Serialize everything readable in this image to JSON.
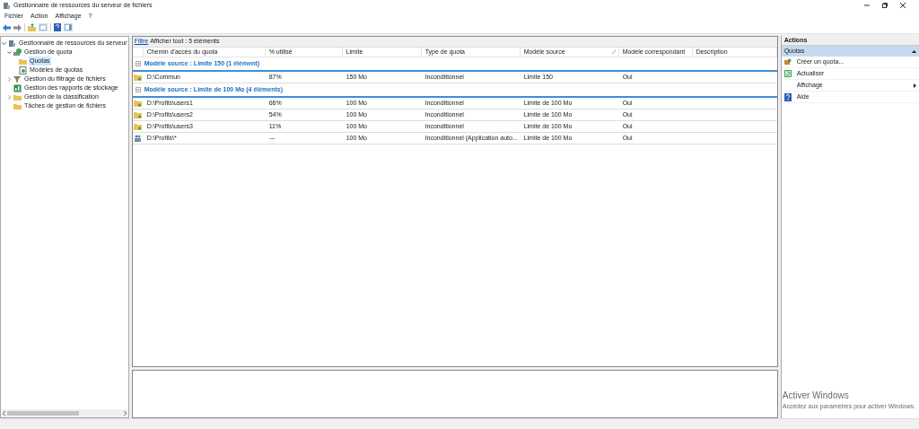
{
  "window": {
    "title": "Gestionnaire de ressources du serveur de fichiers"
  },
  "menu": [
    "Fichier",
    "Action",
    "Affichage",
    "?"
  ],
  "tree": [
    {
      "label": "Gestionnaire de ressources du serveur",
      "kind": "server",
      "expanded": true,
      "selected": false,
      "children": [
        {
          "label": "Gestion de quota",
          "kind": "quota",
          "expanded": true,
          "selected": false,
          "children": [
            {
              "label": "Quotas",
              "kind": "folder",
              "selected": true
            },
            {
              "label": "Modèles de quotas",
              "kind": "template",
              "selected": false
            }
          ]
        },
        {
          "label": "Gestion du filtrage de fichiers",
          "kind": "filter",
          "expanded": false,
          "selected": false
        },
        {
          "label": "Gestion des rapports de stockage",
          "kind": "report",
          "selected": false
        },
        {
          "label": "Gestion de la classification",
          "kind": "folder",
          "expanded": false,
          "selected": false
        },
        {
          "label": "Tâches de gestion de fichiers",
          "kind": "folder",
          "selected": false
        }
      ]
    }
  ],
  "filter": {
    "link": "Filtre",
    "text": "Afficher tout : 5 éléments"
  },
  "table": {
    "columns": [
      {
        "label": "Chemin d'accès du quota",
        "sorted": false
      },
      {
        "label": "% utilisé",
        "sorted": false
      },
      {
        "label": "Limite",
        "sorted": false
      },
      {
        "label": "Type de quota",
        "sorted": false
      },
      {
        "label": "Modèle source",
        "sorted": true
      },
      {
        "label": "Modèle correspondant",
        "sorted": false
      },
      {
        "label": "Description",
        "sorted": false
      }
    ],
    "groups": [
      {
        "title": "Modèle source : Limite 150 (1 élément)",
        "expanded": true,
        "rows": [
          {
            "kind": "folder",
            "cells": [
              "D:\\Commun",
              "87%",
              "150 Mo",
              "Inconditionnel",
              "Limite 150",
              "Oui"
            ]
          }
        ]
      },
      {
        "title": "Modèle source : Limite de 100 Mo (4 éléments)",
        "expanded": true,
        "rows": [
          {
            "kind": "folder",
            "cells": [
              "D:\\Profils\\users1",
              "66%",
              "100 Mo",
              "Inconditionnel",
              "Limite de 100 Mo",
              "Oui"
            ]
          },
          {
            "kind": "folder",
            "cells": [
              "D:\\Profils\\users2",
              "54%",
              "100 Mo",
              "Inconditionnel",
              "Limite de 100 Mo",
              "Oui"
            ]
          },
          {
            "kind": "folder",
            "cells": [
              "D:\\Profils\\users3",
              "11%",
              "100 Mo",
              "Inconditionnel",
              "Limite de 100 Mo",
              "Oui"
            ]
          },
          {
            "kind": "auto",
            "cells": [
              "D:\\Profils\\*",
              "---",
              "100 Mo",
              "Inconditionnel (Application auto...",
              "Limite de 100 Mo",
              "Oui"
            ]
          }
        ]
      }
    ]
  },
  "actions": {
    "title": "Actions",
    "section": "Quotas",
    "items": [
      {
        "label": "Créer un quota...",
        "kind": "create"
      },
      {
        "label": "Actualiser",
        "kind": "refresh"
      },
      {
        "label": "Affichage",
        "kind": "submenu"
      },
      {
        "label": "Aide",
        "kind": "help"
      }
    ]
  },
  "activation": {
    "title": "Activer Windows",
    "text": "Accédez aux paramètres pour activer Windows."
  }
}
